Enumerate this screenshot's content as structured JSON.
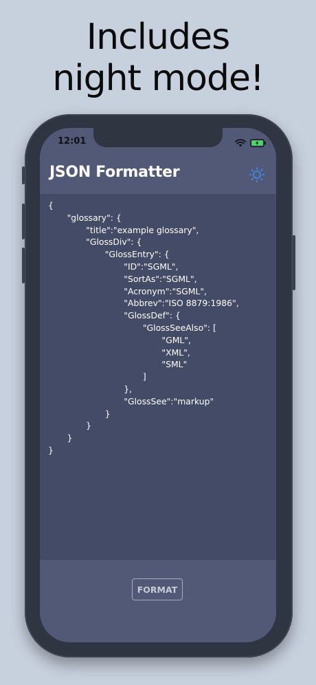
{
  "headline": {
    "line1": "Includes",
    "line2": "night mode!"
  },
  "status_bar": {
    "time": "12:01",
    "icons": [
      "wifi-icon",
      "battery-charging-icon"
    ]
  },
  "nav": {
    "title": "JSON Formatter",
    "theme_toggle_icon": "sun-icon",
    "accent_color": "#3b8ef0"
  },
  "editor": {
    "content": "{\n       \"glossary\": {\n              \"title\":\"example glossary\",\n              \"GlossDiv\": {\n                     \"GlossEntry\": {\n                            \"ID\":\"SGML\",\n                            \"SortAs\":\"SGML\",\n                            \"Acronym\":\"SGML\",\n                            \"Abbrev\":\"ISO 8879:1986\",\n                            \"GlossDef\": {\n                                   \"GlossSeeAlso\": [\n                                          \"GML\",\n                                          \"XML\",\n                                          \"SML\"\n                                   ]\n                            },\n                            \"GlossSee\":\"markup\"\n                     }\n              }\n       }\n}"
  },
  "footer": {
    "format_label": "FORMAT"
  },
  "colors": {
    "background": "#c7d0dd",
    "phone_frame": "#2f3541",
    "bar": "#515976",
    "editor": "#444b66"
  }
}
